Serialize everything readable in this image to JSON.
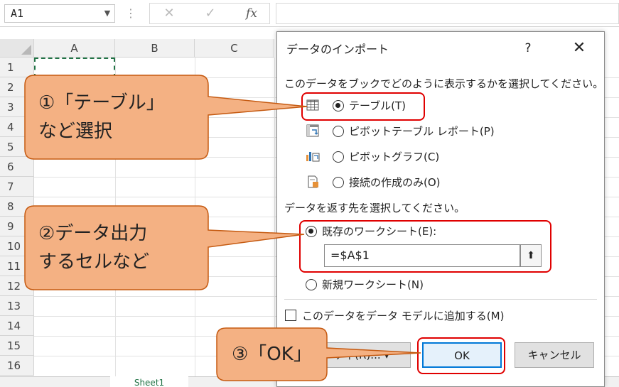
{
  "formula_bar": {
    "name_box": "A1",
    "name_box_arrow": "▼",
    "fx_label": "fx"
  },
  "sheet": {
    "columns": [
      "A",
      "B",
      "C"
    ],
    "rows": [
      "1",
      "2",
      "3",
      "4",
      "5",
      "6",
      "7",
      "8",
      "9",
      "10",
      "11",
      "12",
      "13",
      "14",
      "15",
      "16"
    ],
    "active_cell": "A1",
    "tab_label": "Sheet1"
  },
  "dialog": {
    "title": "データのインポート",
    "help": "?",
    "close": "✕",
    "prompt_view": "このデータをブックでどのように表示するかを選択してください。",
    "view_options": [
      {
        "label": "テーブル(T)",
        "checked": true,
        "icon": "table-icon"
      },
      {
        "label": "ピボットテーブル レポート(P)",
        "checked": false,
        "icon": "pivot-table-icon"
      },
      {
        "label": "ピボットグラフ(C)",
        "checked": false,
        "icon": "pivot-chart-icon"
      },
      {
        "label": "接続の作成のみ(O)",
        "checked": false,
        "icon": "connection-icon"
      }
    ],
    "prompt_dest": "データを返す先を選択してください。",
    "dest_options": [
      {
        "label": "既存のワークシート(E):",
        "checked": true
      },
      {
        "label": "新規ワークシート(N)",
        "checked": false
      }
    ],
    "range_value": "=$A$1",
    "data_model_label": "このデータをデータ モデルに追加する(M)",
    "properties_button": "ティ(R)...",
    "properties_arrow": "▾",
    "ok_button": "OK",
    "cancel_button": "キャンセル"
  },
  "callouts": {
    "step1_line1": "①「テーブル」",
    "step1_line2": "など選択",
    "step2_line1": "②データ出力",
    "step2_line2": "するセルなど",
    "step3": "③「OK」"
  },
  "colors": {
    "callout_fill": "#f4b183",
    "callout_stroke": "#c55a11",
    "highlight_red": "#e00000",
    "excel_green": "#217346"
  }
}
